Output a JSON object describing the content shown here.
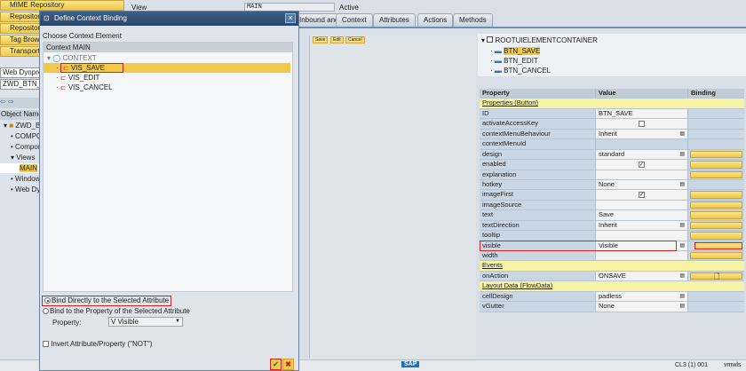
{
  "left_panel": {
    "buttons": [
      "MIME Repository",
      "Repository Browser",
      "Repository Information System",
      "Tag Browser",
      "Transport Organizer"
    ],
    "object_type": "Web Dynpro Comp./Intf.",
    "object_name": "ZWD_BTN_VISIBLE",
    "column_header": "Object Name",
    "tree": [
      "ZWD_BTN_VISIBLE",
      "COMPONENTCONTROLLER",
      "Component Interface",
      "Views",
      "MAIN",
      "Windows",
      "Web Dynpro Applications"
    ]
  },
  "header": {
    "view_label": "View",
    "view_value": "MAIN",
    "status": "Active"
  },
  "tabs": [
    "Inbound and Plugs",
    "Context",
    "Attributes",
    "Actions",
    "Methods"
  ],
  "layout_preview": {
    "buttons": [
      "Save",
      "Edit",
      "Cancel"
    ]
  },
  "ui_tree": {
    "root": "ROOTUIELEMENTCONTAINER",
    "items": [
      "BTN_SAVE",
      "BTN_EDIT",
      "BTN_CANCEL"
    ]
  },
  "properties": {
    "headers": [
      "Property",
      "Value",
      "Binding"
    ],
    "rows": [
      {
        "type": "section",
        "label": "Properties (Button)"
      },
      {
        "name": "ID",
        "value": "BTN_SAVE"
      },
      {
        "name": "activateAccessKey",
        "checkbox": false
      },
      {
        "name": "contextMenuBehaviour",
        "value": "Inherit",
        "f4": true
      },
      {
        "name": "contextMenuId",
        "value": "",
        "grey": true
      },
      {
        "name": "design",
        "value": "standard",
        "f4": true,
        "bind": true
      },
      {
        "name": "enabled",
        "checkbox": true,
        "bind": true
      },
      {
        "name": "explanation",
        "value": "",
        "bind": true
      },
      {
        "name": "hotkey",
        "value": "None",
        "f4": true
      },
      {
        "name": "imageFirst",
        "checkbox": true,
        "bind": true
      },
      {
        "name": "imageSource",
        "value": "",
        "bind": true
      },
      {
        "name": "text",
        "value": "Save",
        "bind": true
      },
      {
        "name": "textDirection",
        "value": "Inherit",
        "f4": true,
        "bind": true
      },
      {
        "name": "tooltip",
        "value": "",
        "bind": true
      },
      {
        "name": "visible",
        "value": "Visible",
        "f4": true,
        "bind": true,
        "highlight": true
      },
      {
        "name": "width",
        "value": "",
        "bind": true
      },
      {
        "type": "section",
        "label": "Events"
      },
      {
        "name": "onAction",
        "value": "ONSAVE",
        "f4": true,
        "bind": true,
        "doc": true
      },
      {
        "type": "section",
        "label": "Layout Data (FlowData)"
      },
      {
        "name": "cellDesign",
        "value": "padless",
        "f4": true
      },
      {
        "name": "vGutter",
        "value": "None",
        "f4": true
      }
    ]
  },
  "dialog": {
    "title": "Define Context Binding",
    "choose_label": "Choose Context Element",
    "context_header": "Context MAIN",
    "root": "CONTEXT",
    "attributes": [
      "VIS_SAVE",
      "VIS_EDIT",
      "VIS_CANCEL"
    ],
    "radio_direct": "Bind Directly to the Selected Attribute",
    "radio_property": "Bind to the Property of the Selected Attribute",
    "property_label": "Property:",
    "property_value": "V Visible",
    "invert_label": "Invert Attribute/Property (\"NOT\")"
  },
  "status_bar": {
    "logo": "SAP",
    "system": "CL3 (1) 001",
    "server": "vmwls"
  },
  "colors": {
    "accent": "#f0c84a",
    "title_bar": "#2a4669",
    "highlight": "#d42020"
  }
}
